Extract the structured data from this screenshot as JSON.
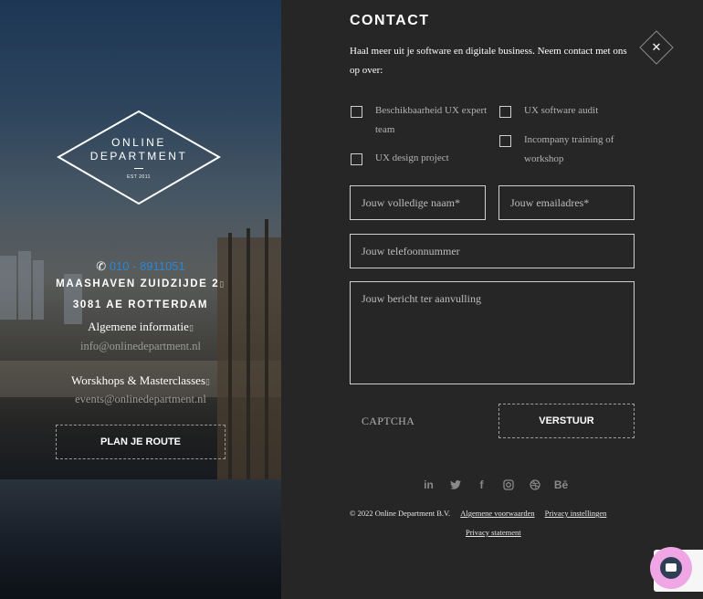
{
  "brand": {
    "logo_line1": "ONLINE",
    "logo_line2": "DEPARTMENT",
    "logo_est": "EST 2011"
  },
  "contact_info": {
    "phone": "010 - 8911051",
    "address_line1": "MAASHAVEN ZUIDZIJDE 2",
    "address_line2": "3081 AE ROTTERDAM",
    "general_label": "Algemene informatie",
    "general_email": "info@onlinedepartment.nl",
    "workshops_label": "Worskhops & Masterclasses",
    "workshops_email": "events@onlinedepartment.nl",
    "route_button": "PLAN JE ROUTE"
  },
  "form": {
    "title": "CONTACT",
    "intro": "Haal meer uit je software en digitale business. Neem contact met ons op over:",
    "checkboxes": [
      "Beschikbaarheid UX expert team",
      "UX design project",
      "UX software audit",
      "Incompany training of workshop"
    ],
    "name_placeholder": "Jouw volledige naam*",
    "email_placeholder": "Jouw emailadres*",
    "phone_placeholder": "Jouw telefoonnummer",
    "message_placeholder": "Jouw bericht ter aanvulling",
    "captcha_label": "CAPTCHA",
    "submit_label": "VERSTUUR"
  },
  "social": [
    {
      "icon": "linkedin-icon",
      "glyph": "in"
    },
    {
      "icon": "twitter-icon",
      "glyph": "🐦"
    },
    {
      "icon": "facebook-icon",
      "glyph": "f"
    },
    {
      "icon": "instagram-icon",
      "glyph": "◎"
    },
    {
      "icon": "dribbble-icon",
      "glyph": "⊛"
    },
    {
      "icon": "behance-icon",
      "glyph": "Bē"
    }
  ],
  "footer": {
    "copyright": "© 2022 Online Department B.V.",
    "terms": "Algemene voorwaarden",
    "privacy_settings": "Privacy instellingen",
    "privacy_statement": "Privacy statement"
  },
  "colors": {
    "panel": "#262626",
    "phone_link": "#2b86d9",
    "chat_bubble": "#f0a6e4"
  }
}
